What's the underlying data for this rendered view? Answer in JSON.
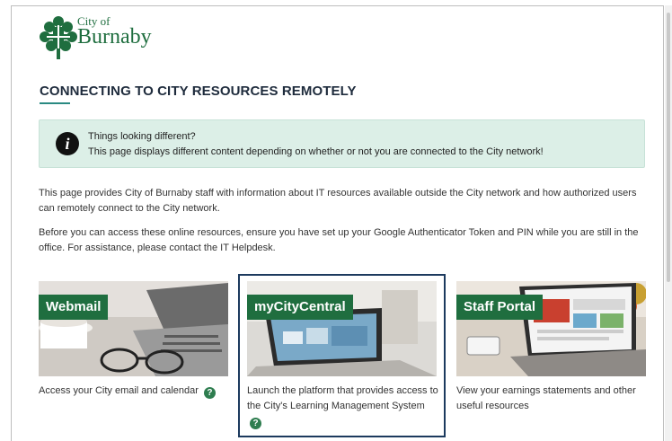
{
  "logo": {
    "line1": "City of",
    "line2": "Burnaby"
  },
  "page": {
    "title": "CONNECTING TO CITY RESOURCES REMOTELY"
  },
  "notice": {
    "icon": "info-icon",
    "icon_glyph": "i",
    "line1": "Things looking different?",
    "line2": "This page displays different content depending on whether or not you are connected to the City network!"
  },
  "content": {
    "paragraph1": "This page provides City of Burnaby staff with information about IT resources available outside the City network and how authorized users can remotely connect to the City network.",
    "paragraph2": "Before you can access these online resources, ensure you have set up your Google Authenticator Token and PIN while you are still in the office. For assistance, please contact the IT Helpdesk."
  },
  "cards": [
    {
      "label": "Webmail",
      "caption": "Access your City email and calendar",
      "help_icon": "?"
    },
    {
      "label": "myCityCentral",
      "caption": "Launch the platform that provides access to the City's Learning Management System",
      "help_icon": "?"
    },
    {
      "label": "Staff Portal",
      "caption": "View your earnings statements and other useful resources"
    }
  ],
  "colors": {
    "brand_green": "#1f6e3f",
    "notice_bg": "#dcefe7",
    "title_accent": "#2a8a82",
    "highlight_border": "#1c3a5e"
  }
}
